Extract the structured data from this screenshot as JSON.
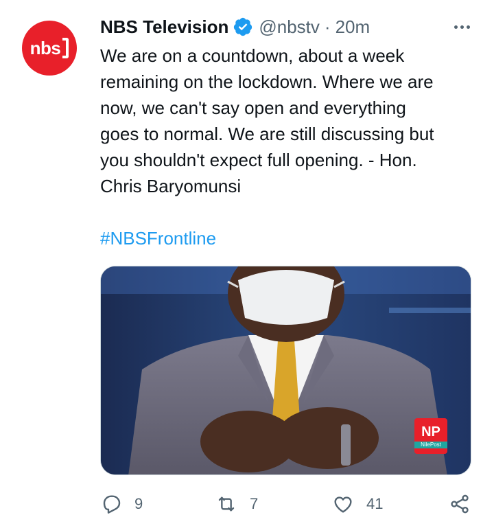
{
  "author": {
    "display_name": "NBS Television",
    "handle": "@nbstv",
    "separator": "·",
    "time": "20m",
    "avatar_text": "nbs",
    "verified": true
  },
  "tweet": {
    "text": "We are on a countdown, about a week\nremaining on the lockdown. Where we are\nnow, we can't say open and everything\ngoes to normal. We are still discussing but\nyou shouldn't expect full opening. - Hon.\nChris Baryomunsi",
    "hashtag": "#NBSFrontline"
  },
  "media": {
    "watermark": "NP",
    "watermark_brand": "NilePost"
  },
  "actions": {
    "reply_count": "9",
    "retweet_count": "7",
    "like_count": "41"
  },
  "colors": {
    "accent": "#1d9bf0",
    "brand": "#e8202a",
    "muted": "#536471"
  }
}
